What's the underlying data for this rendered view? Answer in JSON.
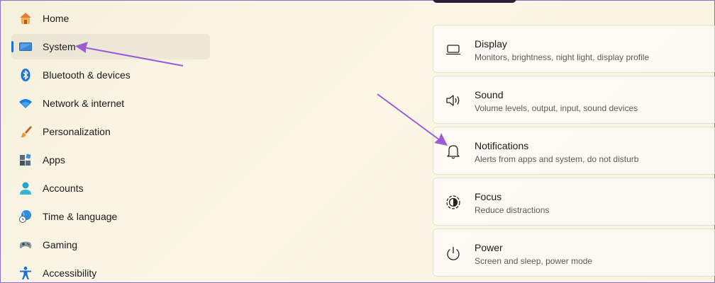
{
  "sidebar": {
    "items": [
      {
        "label": "Home",
        "icon": "home-icon"
      },
      {
        "label": "System",
        "icon": "monitor-icon",
        "active": true
      },
      {
        "label": "Bluetooth & devices",
        "icon": "bluetooth-icon"
      },
      {
        "label": "Network & internet",
        "icon": "wifi-icon"
      },
      {
        "label": "Personalization",
        "icon": "paintbrush-icon"
      },
      {
        "label": "Apps",
        "icon": "apps-icon"
      },
      {
        "label": "Accounts",
        "icon": "account-icon"
      },
      {
        "label": "Time & language",
        "icon": "globe-clock-icon"
      },
      {
        "label": "Gaming",
        "icon": "gamepad-icon"
      },
      {
        "label": "Accessibility",
        "icon": "accessibility-icon"
      }
    ]
  },
  "settings": {
    "cards": [
      {
        "title": "Display",
        "subtitle": "Monitors, brightness, night light, display profile",
        "icon": "display-icon"
      },
      {
        "title": "Sound",
        "subtitle": "Volume levels, output, input, sound devices",
        "icon": "speaker-icon"
      },
      {
        "title": "Notifications",
        "subtitle": "Alerts from apps and system, do not disturb",
        "icon": "bell-icon"
      },
      {
        "title": "Focus",
        "subtitle": "Reduce distractions",
        "icon": "focus-icon"
      },
      {
        "title": "Power",
        "subtitle": "Screen and sleep, power mode",
        "icon": "power-icon"
      }
    ]
  },
  "colors": {
    "accent": "#1f6fd1",
    "annotation_arrow": "#9b5bd6",
    "background": "#f8f2e2"
  }
}
